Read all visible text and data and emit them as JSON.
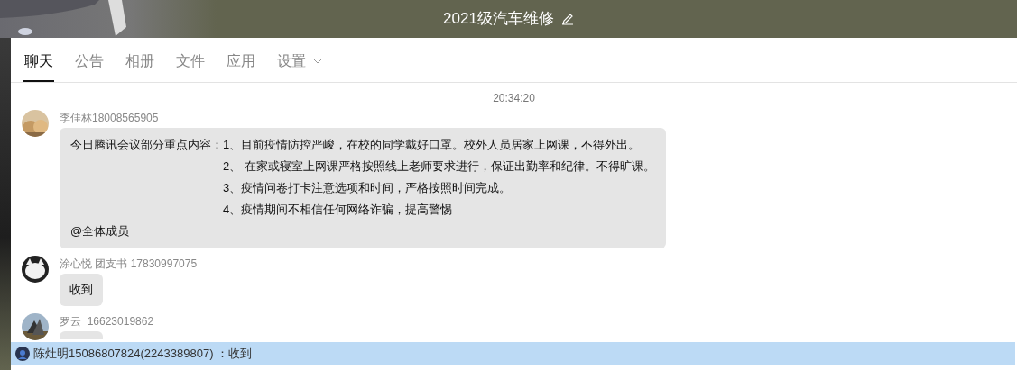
{
  "header": {
    "title": "2021级汽车维修"
  },
  "tabs": [
    {
      "label": "聊天",
      "selected": true,
      "dropdown": false
    },
    {
      "label": "公告",
      "selected": false,
      "dropdown": false
    },
    {
      "label": "相册",
      "selected": false,
      "dropdown": false
    },
    {
      "label": "文件",
      "selected": false,
      "dropdown": false
    },
    {
      "label": "应用",
      "selected": false,
      "dropdown": false
    },
    {
      "label": "设置",
      "selected": false,
      "dropdown": true
    }
  ],
  "timestamp": "20:34:20",
  "messages": [
    {
      "sender": "李佳林18008565905",
      "kind": "list",
      "intro": "今日腾讯会议部分重点内容：",
      "items": [
        "1、目前疫情防控严峻，在校的同学戴好口罩。校外人员居家上网课，不得外出。",
        "2、 在家或寝室上网课严格按照线上老师要求进行，保证出勤率和纪律。不得旷课。",
        "3、疫情问卷打卡注意选项和时间，严格按照时间完成。",
        "4、疫情期间不相信任何网络诈骗，提高警惕"
      ],
      "mention": "@全体成员"
    },
    {
      "sender": "涂心悦 团支书 17830997075",
      "kind": "text",
      "text": "收到"
    },
    {
      "sender": "罗云  16623019862",
      "kind": "covered"
    }
  ],
  "notification": {
    "text": "陈灶明15086807824(2243389807) ：收到"
  }
}
